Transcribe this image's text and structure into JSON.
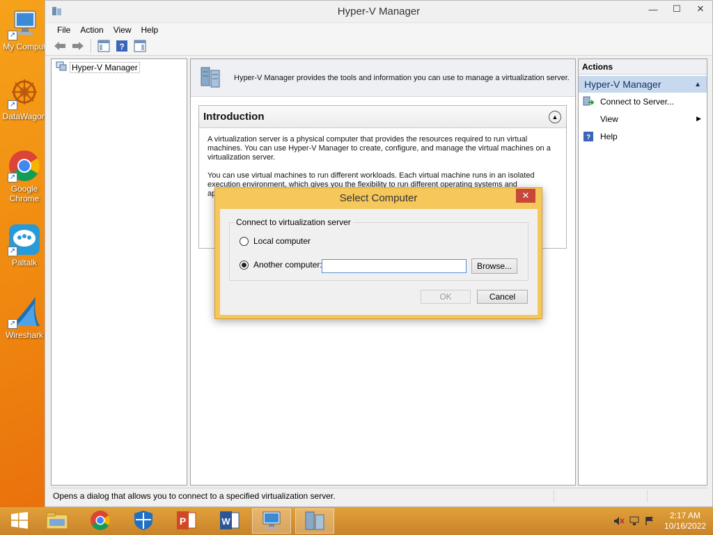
{
  "desktop": {
    "icons": [
      {
        "label": "My Comput",
        "icon": "computer-icon"
      },
      {
        "label": "DataWagon",
        "icon": "datawagon-icon"
      },
      {
        "label": "Google Chrome",
        "icon": "chrome-icon"
      },
      {
        "label": "Paltalk",
        "icon": "paltalk-icon"
      },
      {
        "label": "Wireshark",
        "icon": "wireshark-icon"
      }
    ]
  },
  "window": {
    "title": "Hyper-V Manager",
    "menu": [
      "File",
      "Action",
      "View",
      "Help"
    ],
    "tree": {
      "root": "Hyper-V Manager"
    },
    "center": {
      "header_text": "Hyper-V Manager provides the tools and information you can use to manage a virtualization server.",
      "intro_title": "Introduction",
      "intro_p1": "A virtualization server is a physical computer that provides the resources required to run virtual machines. You can use Hyper-V Manager to create, configure, and manage the virtual machines on a virtualization server.",
      "intro_p2": "You can use virtual machines to run different workloads. Each virtual machine runs in an isolated execution environment, which gives you the flexibility to run different operating systems and applications on on"
    },
    "actions": {
      "header": "Actions",
      "group": "Hyper-V Manager",
      "items": [
        "Connect to Server...",
        "View",
        "Help"
      ]
    },
    "status": "Opens a dialog that allows you to connect to a specified virtualization server."
  },
  "dialog": {
    "title": "Select Computer",
    "close": "✕",
    "group_label": "Connect to virtualization server",
    "option_local": "Local computer",
    "option_another": "Another computer:",
    "selected_option": "Another computer:",
    "computer_value": "",
    "browse": "Browse...",
    "ok": "OK",
    "cancel": "Cancel"
  },
  "taskbar": {
    "apps": [
      "start-icon",
      "file-explorer-icon",
      "chrome-icon",
      "defender-icon",
      "powerpoint-icon",
      "word-icon",
      "remote-desktop-icon",
      "hyper-v-icon"
    ],
    "time": "2:17 AM",
    "date": "10/16/2022"
  },
  "colors": {
    "desktop": "#f08a10",
    "dialog_frame": "#f6c75a",
    "selection": "#c6d9ef",
    "close": "#c7473a"
  }
}
